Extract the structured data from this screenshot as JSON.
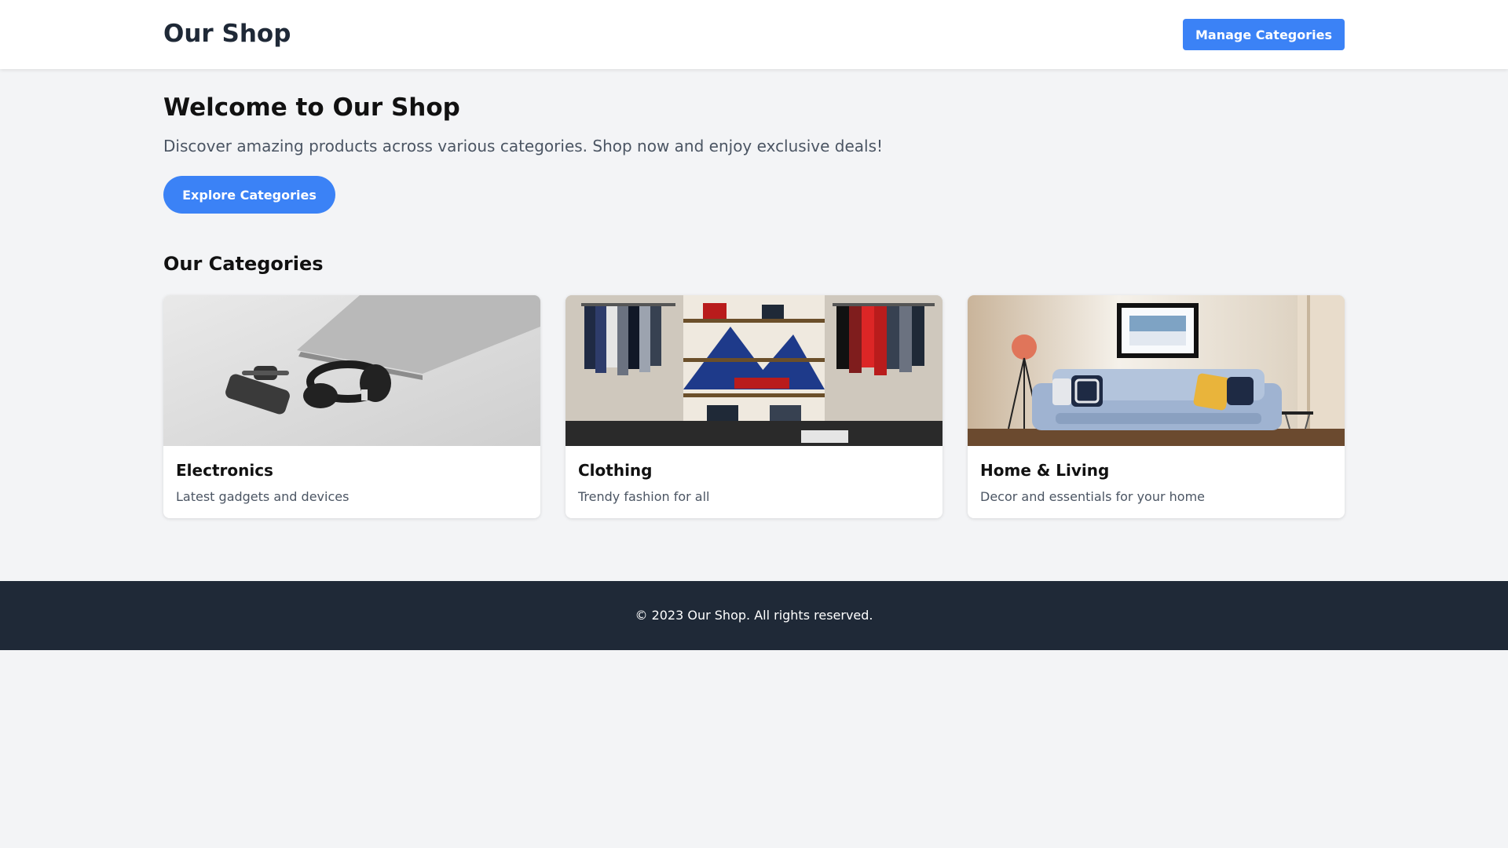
{
  "header": {
    "brand": "Our Shop",
    "manage_label": "Manage Categories"
  },
  "hero": {
    "title": "Welcome to Our Shop",
    "subtitle": "Discover amazing products across various categories. Shop now and enjoy exclusive deals!",
    "cta_label": "Explore Categories"
  },
  "categories": {
    "heading": "Our Categories",
    "items": [
      {
        "name": "Electronics",
        "description": "Latest gadgets and devices",
        "image": "electronics-photo"
      },
      {
        "name": "Clothing",
        "description": "Trendy fashion for all",
        "image": "clothing-store-photo"
      },
      {
        "name": "Home & Living",
        "description": "Decor and essentials for your home",
        "image": "living-room-photo"
      }
    ]
  },
  "footer": {
    "copyright": "© 2023 Our Shop. All rights reserved."
  },
  "colors": {
    "accent": "#3b82f6",
    "page_bg": "#f3f4f6",
    "footer_bg": "#1f2937"
  }
}
